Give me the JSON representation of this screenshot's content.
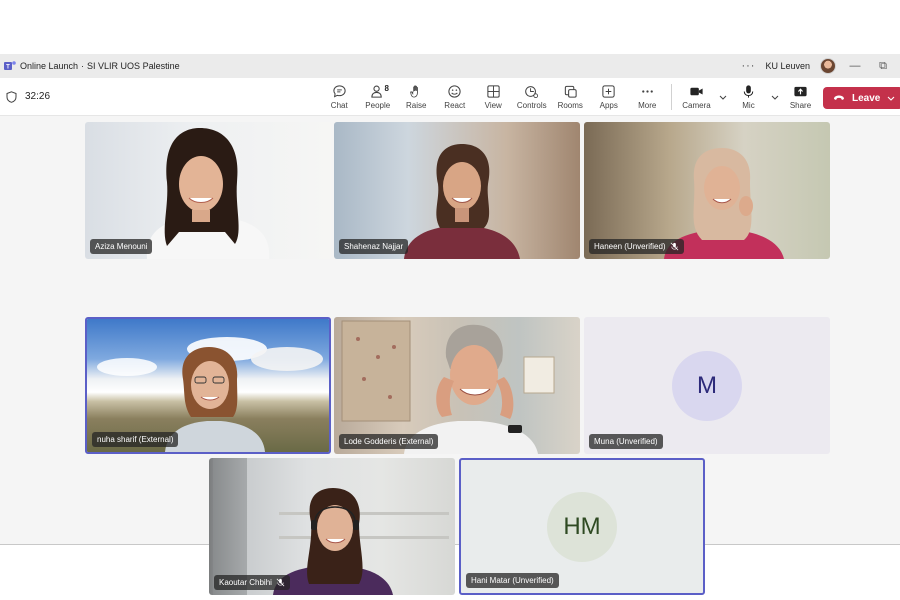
{
  "window": {
    "title": "Online Launch",
    "subtitle": "SI VLIR UOS Palestine",
    "org": "KU Leuven",
    "minimize": "—",
    "restore": "⧉"
  },
  "toolbar": {
    "timer": "32:26",
    "people_count": "8",
    "items": [
      {
        "label": "Chat",
        "icon": "chat-icon"
      },
      {
        "label": "People",
        "icon": "people-icon"
      },
      {
        "label": "Raise",
        "icon": "raise-hand-icon"
      },
      {
        "label": "React",
        "icon": "react-icon"
      },
      {
        "label": "View",
        "icon": "view-icon"
      },
      {
        "label": "Controls",
        "icon": "controls-icon"
      },
      {
        "label": "Rooms",
        "icon": "rooms-icon"
      },
      {
        "label": "Apps",
        "icon": "apps-icon"
      },
      {
        "label": "More",
        "icon": "more-icon"
      }
    ],
    "camera_label": "Camera",
    "mic_label": "Mic",
    "share_label": "Share",
    "leave_label": "Leave"
  },
  "colors": {
    "accent": "#5b5fc7",
    "leave": "#c4314b",
    "m_initials": "#2d2a7a",
    "hm_initials": "#2e4a22"
  },
  "participants": [
    {
      "name": "Aziza Menouni",
      "muted": false
    },
    {
      "name": "Shahenaz Najjar",
      "muted": false
    },
    {
      "name": "Haneen (Unverified)",
      "muted": true
    },
    {
      "name": "nuha sharif (External)",
      "muted": false,
      "active_speaker": true
    },
    {
      "name": "Lode Godderis (External)",
      "muted": false
    },
    {
      "name": "Muna (Unverified)",
      "muted": false,
      "initials": "M"
    },
    {
      "name": "Kaoutar Chbihi",
      "muted": true
    },
    {
      "name": "Hani Matar (Unverified)",
      "muted": false,
      "initials": "HM",
      "active_speaker": true
    }
  ]
}
